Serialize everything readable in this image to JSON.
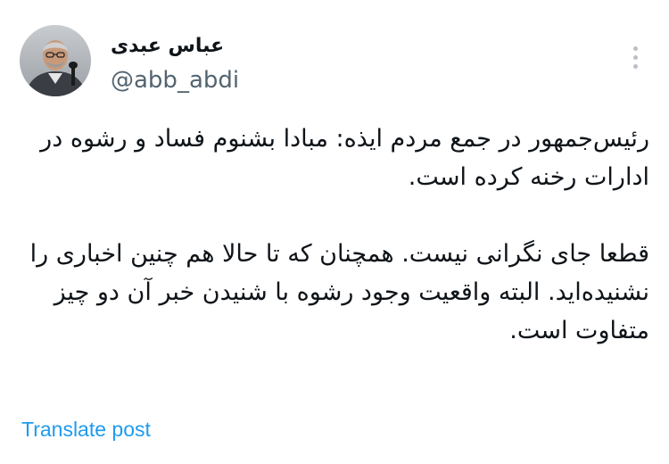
{
  "author": {
    "display_name": "عباس عبدی",
    "handle": "@abb_abdi"
  },
  "icons": {
    "avatar": "avatar-photo",
    "more": "more-vertical-icon"
  },
  "tweet": {
    "paragraph_1": "رئیس‌جمهور در جمع مردم ایذه: مبادا بشنوم فساد و رشوه در ادارات رخنه کرده است.",
    "paragraph_2": "قطعا جای نگرانی نیست. همچنان که تا حالا هم چنین اخباری را نشنیده‌اید. البته واقعیت وجود رشوه با شنیدن خبر آن دو چیز متفاوت است."
  },
  "actions": {
    "translate_label": "Translate post"
  },
  "colors": {
    "text": "#0f1419",
    "muted": "#536471",
    "link": "#1d9bf0"
  }
}
